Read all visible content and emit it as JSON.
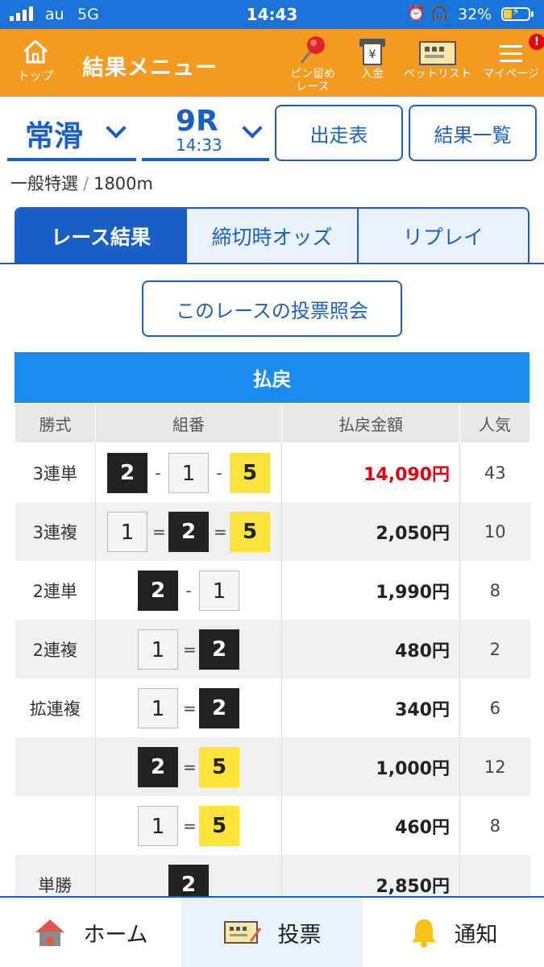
{
  "status_bar": {
    "carrier": "au",
    "network": "5G",
    "time": "14:43",
    "battery": "32%",
    "battery_level": 0.32
  },
  "header": {
    "top_label": "トップ",
    "title": "結果メニュー",
    "items": [
      {
        "label_line1": "ピン留め",
        "label_line2": "レース",
        "icon": "pin-icon"
      },
      {
        "label_line1": "入金",
        "label_line2": "",
        "icon": "deposit-icon"
      },
      {
        "label_line1": "ベットリスト",
        "label_line2": "",
        "icon": "bet-list-icon"
      },
      {
        "label_line1": "マイページ",
        "label_line2": "",
        "icon": "menu-icon",
        "badge": "!"
      }
    ]
  },
  "race": {
    "venue": "常滑",
    "race_no": "9R",
    "race_time": "14:33",
    "entry_button": "出走表",
    "results_button": "結果一覧",
    "class": "一般特選",
    "class_sep": "/",
    "distance": "1800m"
  },
  "tabs": [
    "レース結果",
    "締切時オッズ",
    "リプレイ"
  ],
  "inquiry_button": "このレースの投票照会",
  "payout": {
    "title": "払戻",
    "columns": [
      "勝式",
      "組番",
      "払戻金額",
      "人気"
    ],
    "rows": [
      {
        "type": "3連単",
        "c": [
          "2",
          "1",
          "5"
        ],
        "s": [
          "-",
          "-"
        ],
        "amount": "14,090円",
        "pop": "43"
      },
      {
        "type": "3連複",
        "c": [
          "1",
          "2",
          "5"
        ],
        "s": [
          "=",
          "="
        ],
        "amount": "2,050円",
        "pop": "10"
      },
      {
        "type": "2連単",
        "c": [
          "2",
          "1"
        ],
        "s": [
          "-"
        ],
        "amount": "1,990円",
        "pop": "8"
      },
      {
        "type": "2連複",
        "c": [
          "1",
          "2"
        ],
        "s": [
          "="
        ],
        "amount": "480円",
        "pop": "2"
      },
      {
        "type": "拡連複",
        "c": [
          "1",
          "2"
        ],
        "s": [
          "="
        ],
        "amount": "340円",
        "pop": "6"
      },
      {
        "type": "",
        "c": [
          "2",
          "5"
        ],
        "s": [
          "="
        ],
        "amount": "1,000円",
        "pop": "12"
      },
      {
        "type": "",
        "c": [
          "1",
          "5"
        ],
        "s": [
          "="
        ],
        "amount": "460円",
        "pop": "8"
      },
      {
        "type": "単勝",
        "c": [
          "2"
        ],
        "s": [],
        "amount": "2,850円",
        "pop": ""
      }
    ]
  },
  "bottom_nav": {
    "home": "ホーム",
    "vote": "投票",
    "notify": "通知"
  },
  "colors": {
    "header_orange": "#f39a1f",
    "brand_blue": "#1a5fc8",
    "status_blue": "#1a73d9",
    "payout_header": "#1a8cf0",
    "highlight_red": "#e60012",
    "boat_2": "#222222",
    "boat_5": "#fde23b"
  }
}
